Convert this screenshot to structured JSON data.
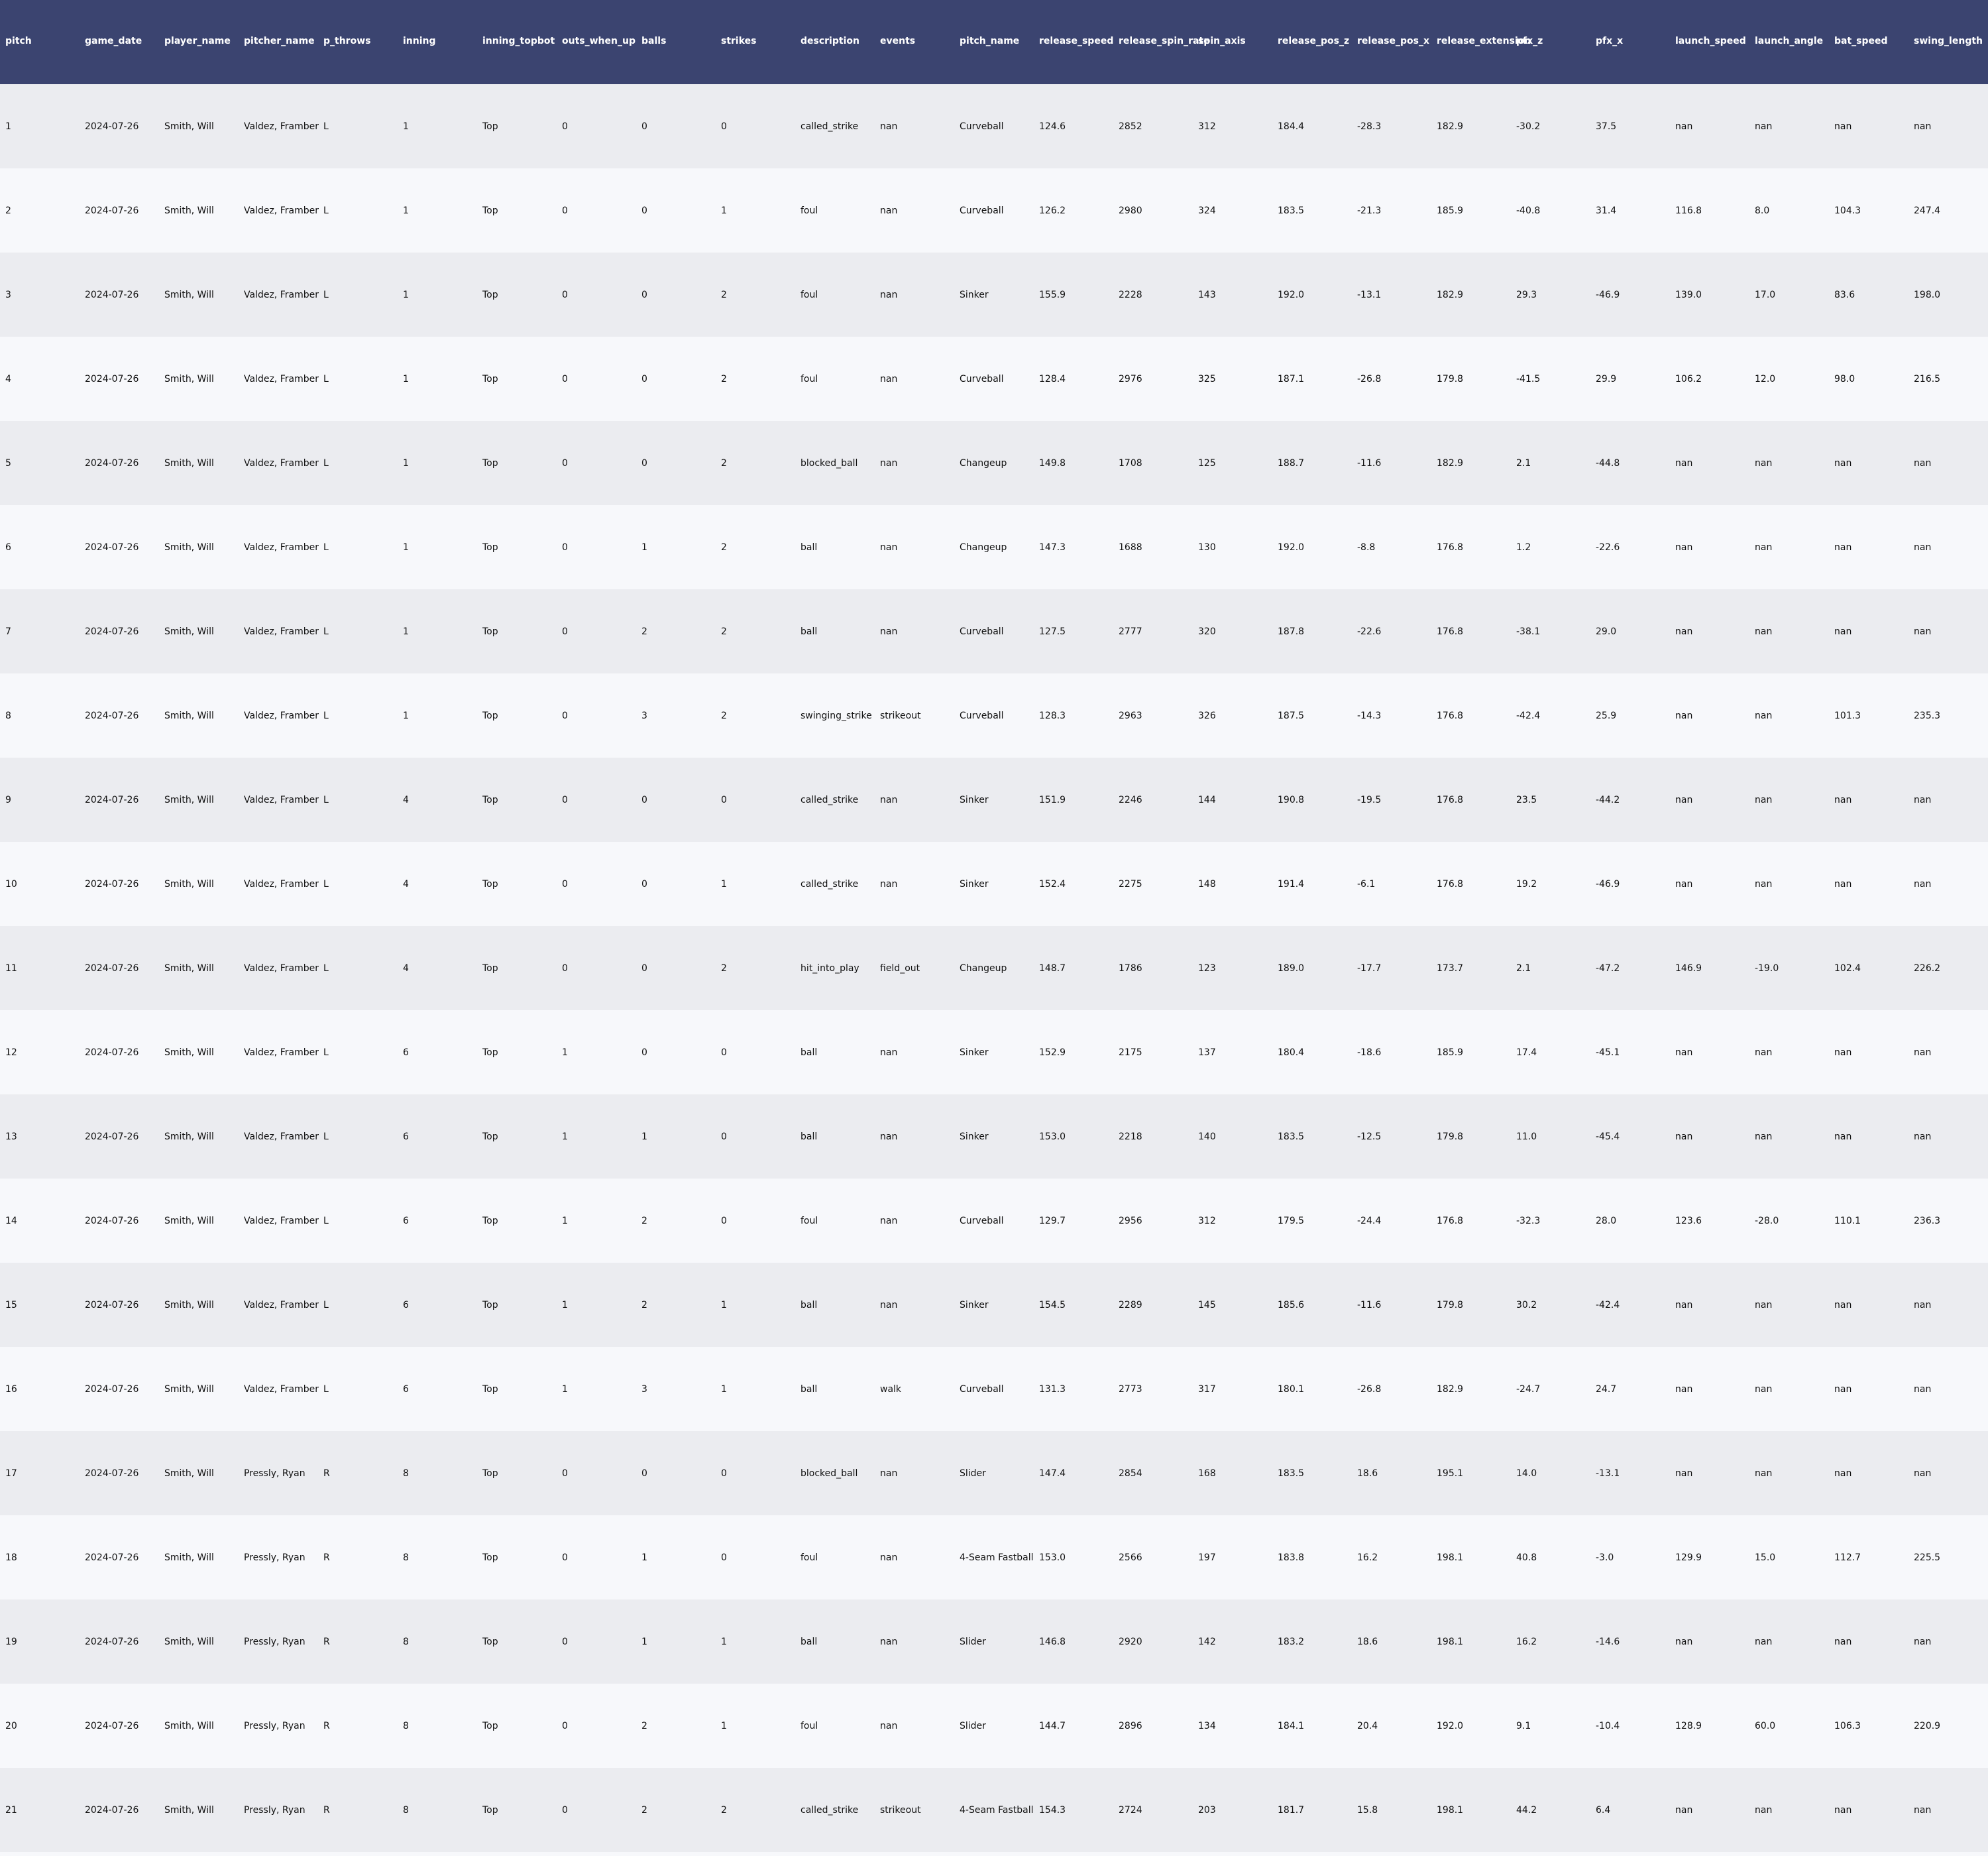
{
  "table": {
    "columns": [
      "pitch",
      "game_date",
      "player_name",
      "pitcher_name",
      "p_throws",
      "inning",
      "inning_topbot",
      "outs_when_up",
      "balls",
      "strikes",
      "description",
      "events",
      "pitch_name",
      "release_speed",
      "release_spin_rate",
      "spin_axis",
      "release_pos_z",
      "release_pos_x",
      "release_extension",
      "pfx_z",
      "pfx_x",
      "launch_speed",
      "launch_angle",
      "bat_speed",
      "swing_length"
    ],
    "rows": [
      [
        "1",
        "2024-07-26",
        "Smith, Will",
        "Valdez, Framber",
        "L",
        "1",
        "Top",
        "0",
        "0",
        "0",
        "called_strike",
        "nan",
        "Curveball",
        "124.6",
        "2852",
        "312",
        "184.4",
        "-28.3",
        "182.9",
        "-30.2",
        "37.5",
        "nan",
        "nan",
        "nan",
        "nan"
      ],
      [
        "2",
        "2024-07-26",
        "Smith, Will",
        "Valdez, Framber",
        "L",
        "1",
        "Top",
        "0",
        "0",
        "1",
        "foul",
        "nan",
        "Curveball",
        "126.2",
        "2980",
        "324",
        "183.5",
        "-21.3",
        "185.9",
        "-40.8",
        "31.4",
        "116.8",
        "8.0",
        "104.3",
        "247.4"
      ],
      [
        "3",
        "2024-07-26",
        "Smith, Will",
        "Valdez, Framber",
        "L",
        "1",
        "Top",
        "0",
        "0",
        "2",
        "foul",
        "nan",
        "Sinker",
        "155.9",
        "2228",
        "143",
        "192.0",
        "-13.1",
        "182.9",
        "29.3",
        "-46.9",
        "139.0",
        "17.0",
        "83.6",
        "198.0"
      ],
      [
        "4",
        "2024-07-26",
        "Smith, Will",
        "Valdez, Framber",
        "L",
        "1",
        "Top",
        "0",
        "0",
        "2",
        "foul",
        "nan",
        "Curveball",
        "128.4",
        "2976",
        "325",
        "187.1",
        "-26.8",
        "179.8",
        "-41.5",
        "29.9",
        "106.2",
        "12.0",
        "98.0",
        "216.5"
      ],
      [
        "5",
        "2024-07-26",
        "Smith, Will",
        "Valdez, Framber",
        "L",
        "1",
        "Top",
        "0",
        "0",
        "2",
        "blocked_ball",
        "nan",
        "Changeup",
        "149.8",
        "1708",
        "125",
        "188.7",
        "-11.6",
        "182.9",
        "2.1",
        "-44.8",
        "nan",
        "nan",
        "nan",
        "nan"
      ],
      [
        "6",
        "2024-07-26",
        "Smith, Will",
        "Valdez, Framber",
        "L",
        "1",
        "Top",
        "0",
        "1",
        "2",
        "ball",
        "nan",
        "Changeup",
        "147.3",
        "1688",
        "130",
        "192.0",
        "-8.8",
        "176.8",
        "1.2",
        "-22.6",
        "nan",
        "nan",
        "nan",
        "nan"
      ],
      [
        "7",
        "2024-07-26",
        "Smith, Will",
        "Valdez, Framber",
        "L",
        "1",
        "Top",
        "0",
        "2",
        "2",
        "ball",
        "nan",
        "Curveball",
        "127.5",
        "2777",
        "320",
        "187.8",
        "-22.6",
        "176.8",
        "-38.1",
        "29.0",
        "nan",
        "nan",
        "nan",
        "nan"
      ],
      [
        "8",
        "2024-07-26",
        "Smith, Will",
        "Valdez, Framber",
        "L",
        "1",
        "Top",
        "0",
        "3",
        "2",
        "swinging_strike",
        "strikeout",
        "Curveball",
        "128.3",
        "2963",
        "326",
        "187.5",
        "-14.3",
        "176.8",
        "-42.4",
        "25.9",
        "nan",
        "nan",
        "101.3",
        "235.3"
      ],
      [
        "9",
        "2024-07-26",
        "Smith, Will",
        "Valdez, Framber",
        "L",
        "4",
        "Top",
        "0",
        "0",
        "0",
        "called_strike",
        "nan",
        "Sinker",
        "151.9",
        "2246",
        "144",
        "190.8",
        "-19.5",
        "176.8",
        "23.5",
        "-44.2",
        "nan",
        "nan",
        "nan",
        "nan"
      ],
      [
        "10",
        "2024-07-26",
        "Smith, Will",
        "Valdez, Framber",
        "L",
        "4",
        "Top",
        "0",
        "0",
        "1",
        "called_strike",
        "nan",
        "Sinker",
        "152.4",
        "2275",
        "148",
        "191.4",
        "-6.1",
        "176.8",
        "19.2",
        "-46.9",
        "nan",
        "nan",
        "nan",
        "nan"
      ],
      [
        "11",
        "2024-07-26",
        "Smith, Will",
        "Valdez, Framber",
        "L",
        "4",
        "Top",
        "0",
        "0",
        "2",
        "hit_into_play",
        "field_out",
        "Changeup",
        "148.7",
        "1786",
        "123",
        "189.0",
        "-17.7",
        "173.7",
        "2.1",
        "-47.2",
        "146.9",
        "-19.0",
        "102.4",
        "226.2"
      ],
      [
        "12",
        "2024-07-26",
        "Smith, Will",
        "Valdez, Framber",
        "L",
        "6",
        "Top",
        "1",
        "0",
        "0",
        "ball",
        "nan",
        "Sinker",
        "152.9",
        "2175",
        "137",
        "180.4",
        "-18.6",
        "185.9",
        "17.4",
        "-45.1",
        "nan",
        "nan",
        "nan",
        "nan"
      ],
      [
        "13",
        "2024-07-26",
        "Smith, Will",
        "Valdez, Framber",
        "L",
        "6",
        "Top",
        "1",
        "1",
        "0",
        "ball",
        "nan",
        "Sinker",
        "153.0",
        "2218",
        "140",
        "183.5",
        "-12.5",
        "179.8",
        "11.0",
        "-45.4",
        "nan",
        "nan",
        "nan",
        "nan"
      ],
      [
        "14",
        "2024-07-26",
        "Smith, Will",
        "Valdez, Framber",
        "L",
        "6",
        "Top",
        "1",
        "2",
        "0",
        "foul",
        "nan",
        "Curveball",
        "129.7",
        "2956",
        "312",
        "179.5",
        "-24.4",
        "176.8",
        "-32.3",
        "28.0",
        "123.6",
        "-28.0",
        "110.1",
        "236.3"
      ],
      [
        "15",
        "2024-07-26",
        "Smith, Will",
        "Valdez, Framber",
        "L",
        "6",
        "Top",
        "1",
        "2",
        "1",
        "ball",
        "nan",
        "Sinker",
        "154.5",
        "2289",
        "145",
        "185.6",
        "-11.6",
        "179.8",
        "30.2",
        "-42.4",
        "nan",
        "nan",
        "nan",
        "nan"
      ],
      [
        "16",
        "2024-07-26",
        "Smith, Will",
        "Valdez, Framber",
        "L",
        "6",
        "Top",
        "1",
        "3",
        "1",
        "ball",
        "walk",
        "Curveball",
        "131.3",
        "2773",
        "317",
        "180.1",
        "-26.8",
        "182.9",
        "-24.7",
        "24.7",
        "nan",
        "nan",
        "nan",
        "nan"
      ],
      [
        "17",
        "2024-07-26",
        "Smith, Will",
        "Pressly, Ryan",
        "R",
        "8",
        "Top",
        "0",
        "0",
        "0",
        "blocked_ball",
        "nan",
        "Slider",
        "147.4",
        "2854",
        "168",
        "183.5",
        "18.6",
        "195.1",
        "14.0",
        "-13.1",
        "nan",
        "nan",
        "nan",
        "nan"
      ],
      [
        "18",
        "2024-07-26",
        "Smith, Will",
        "Pressly, Ryan",
        "R",
        "8",
        "Top",
        "0",
        "1",
        "0",
        "foul",
        "nan",
        "4-Seam Fastball",
        "153.0",
        "2566",
        "197",
        "183.8",
        "16.2",
        "198.1",
        "40.8",
        "-3.0",
        "129.9",
        "15.0",
        "112.7",
        "225.5"
      ],
      [
        "19",
        "2024-07-26",
        "Smith, Will",
        "Pressly, Ryan",
        "R",
        "8",
        "Top",
        "0",
        "1",
        "1",
        "ball",
        "nan",
        "Slider",
        "146.8",
        "2920",
        "142",
        "183.2",
        "18.6",
        "198.1",
        "16.2",
        "-14.6",
        "nan",
        "nan",
        "nan",
        "nan"
      ],
      [
        "20",
        "2024-07-26",
        "Smith, Will",
        "Pressly, Ryan",
        "R",
        "8",
        "Top",
        "0",
        "2",
        "1",
        "foul",
        "nan",
        "Slider",
        "144.7",
        "2896",
        "134",
        "184.1",
        "20.4",
        "192.0",
        "9.1",
        "-10.4",
        "128.9",
        "60.0",
        "106.3",
        "220.9"
      ],
      [
        "21",
        "2024-07-26",
        "Smith, Will",
        "Pressly, Ryan",
        "R",
        "8",
        "Top",
        "0",
        "2",
        "2",
        "called_strike",
        "strikeout",
        "4-Seam Fastball",
        "154.3",
        "2724",
        "203",
        "181.7",
        "15.8",
        "198.1",
        "44.2",
        "6.4",
        "nan",
        "nan",
        "nan",
        "nan"
      ]
    ]
  }
}
